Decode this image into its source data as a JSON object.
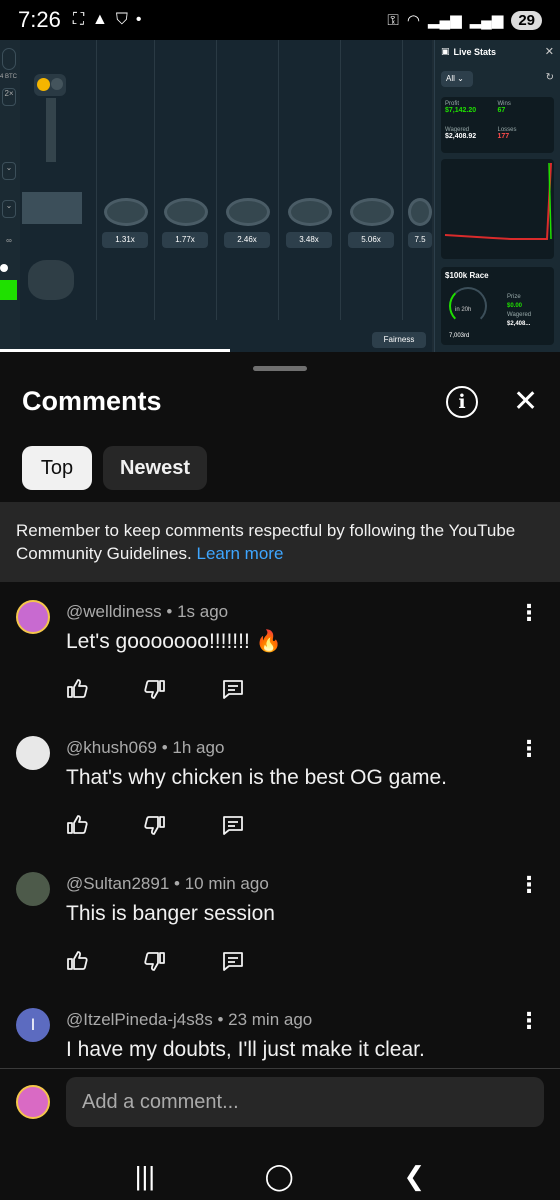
{
  "status_bar": {
    "time": "7:26",
    "battery": "29"
  },
  "video": {
    "game": {
      "left_panel_label_btc": "4 BTC",
      "left_panel_label_mult": "2×",
      "multipliers": [
        "1.31x",
        "1.77x",
        "2.46x",
        "3.48x",
        "5.06x",
        "7.5"
      ],
      "fairness_label": "Fairness",
      "progress": 0.41
    },
    "live_stats": {
      "title": "Live Stats",
      "filter": "All",
      "profit_label": "Profit",
      "profit_value": "$7,142.20",
      "wins_label": "Wins",
      "wins_value": "67",
      "wagered_label": "Wagered",
      "wagered_value": "$2,408.92",
      "losses_label": "Losses",
      "losses_value": "177",
      "race_title": "$100k Race",
      "race_time": "in 20h",
      "race_rank": "7,003rd",
      "prize_label": "Prize",
      "prize_value": "$0.00",
      "race_wagered_label": "Wagered",
      "race_wagered_value": "$2,408..."
    }
  },
  "sheet": {
    "title": "Comments",
    "tabs": [
      "Top",
      "Newest"
    ],
    "notice_text": "Remember to keep comments respectful by following the YouTube Community Guidelines.",
    "notice_link": "Learn more",
    "comments": [
      {
        "author": "@welldiness",
        "time": "1s ago",
        "text": "Let's gooooooo!!!!!!! 🔥",
        "avatar_color": "#c86ad0"
      },
      {
        "author": "@khush069",
        "time": "1h ago",
        "text": "That's why chicken is the best OG game.",
        "avatar_color": "#d8d8d8"
      },
      {
        "author": "@Sultan2891",
        "time": "10 min ago",
        "text": "This is banger session",
        "avatar_color": "#5a6a5a"
      },
      {
        "author": "@ItzelPineda-j4s8s",
        "time": "23 min ago",
        "text": "I have my doubts, I'll just make it clear.",
        "avatar_color": "#5c6bc0",
        "avatar_letter": "I"
      }
    ],
    "add_comment_placeholder": "Add a comment..."
  },
  "colors": {
    "accent_link": "#3ea6ff",
    "background": "#0f0f0f",
    "notice_bg": "#272727",
    "green": "#1fe000"
  },
  "icons": [
    "like-icon",
    "dislike-icon",
    "reply-icon",
    "more-vert-icon",
    "info-icon",
    "close-icon",
    "recents-icon",
    "home-icon",
    "back-icon"
  ]
}
